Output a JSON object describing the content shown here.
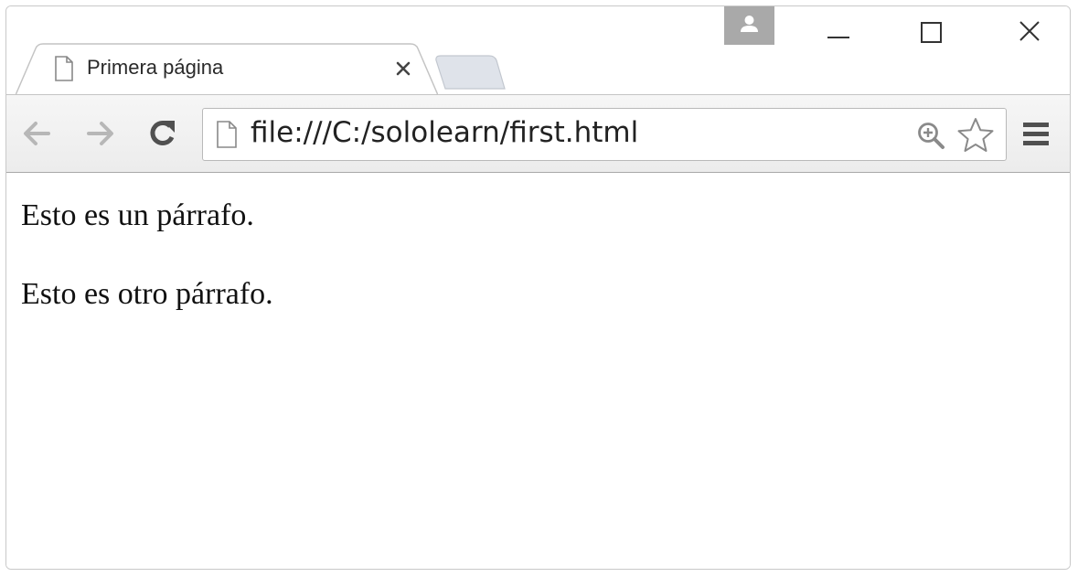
{
  "tab": {
    "title": "Primera página"
  },
  "address_bar": {
    "url": "file:///C:/sololearn/first.html"
  },
  "content": {
    "paragraphs": [
      "Esto es un párrafo.",
      "Esto es otro párrafo."
    ]
  },
  "icons": {
    "tab": [
      "page-icon",
      "close-icon"
    ],
    "window": [
      "profile-icon",
      "minimize-icon",
      "maximize-icon",
      "close-icon"
    ],
    "toolbar": [
      "back-arrow-icon",
      "forward-arrow-icon",
      "reload-icon",
      "page-icon",
      "zoom-icon",
      "star-icon",
      "menu-icon"
    ]
  },
  "colors": {
    "profile_button": "#a9a9a9",
    "toolbar": "#f0f0f0",
    "new_tab": "#dfe3ea"
  }
}
